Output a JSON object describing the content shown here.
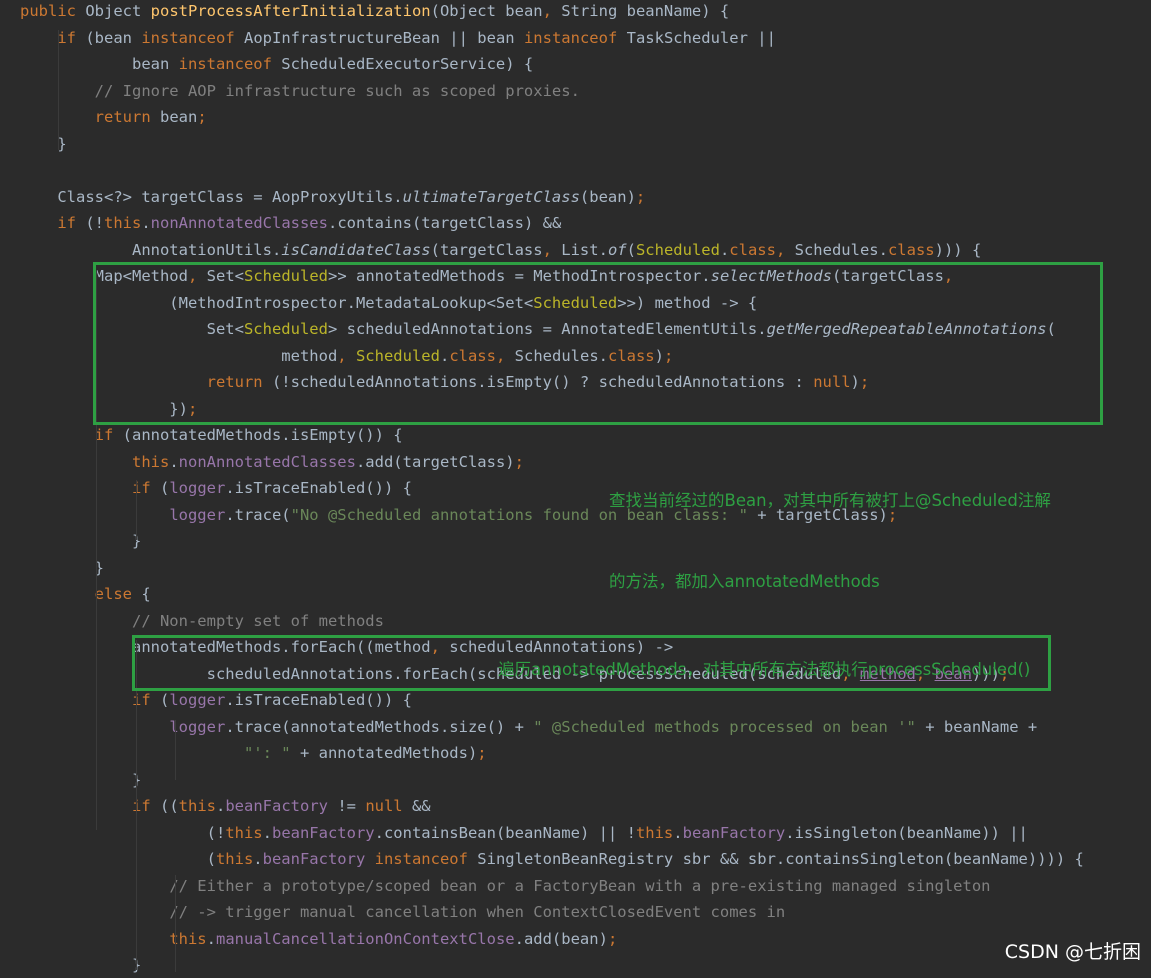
{
  "code": {
    "lines": [
      [
        "public Object postProcessAfterInitialization(Object bean, String beanName) {"
      ],
      [
        "    if (bean instanceof AopInfrastructureBean || bean instanceof TaskScheduler ||"
      ],
      [
        "            bean instanceof ScheduledExecutorService) {"
      ],
      [
        "        // Ignore AOP infrastructure such as scoped proxies."
      ],
      [
        "        return bean;"
      ],
      [
        "    }"
      ],
      [
        ""
      ],
      [
        "    Class<?> targetClass = AopProxyUtils.ultimateTargetClass(bean);"
      ],
      [
        "    if (!this.nonAnnotatedClasses.contains(targetClass) &&"
      ],
      [
        "            AnnotationUtils.isCandidateClass(targetClass, List.of(Scheduled.class, Schedules.class))) {"
      ],
      [
        "        Map<Method, Set<Scheduled>> annotatedMethods = MethodIntrospector.selectMethods(targetClass,"
      ],
      [
        "                (MethodIntrospector.MetadataLookup<Set<Scheduled>>) method -> {"
      ],
      [
        "                    Set<Scheduled> scheduledAnnotations = AnnotatedElementUtils.getMergedRepeatableAnnotations("
      ],
      [
        "                            method, Scheduled.class, Schedules.class);"
      ],
      [
        "                    return (!scheduledAnnotations.isEmpty() ? scheduledAnnotations : null);"
      ],
      [
        "                });"
      ],
      [
        "        if (annotatedMethods.isEmpty()) {"
      ],
      [
        "            this.nonAnnotatedClasses.add(targetClass);"
      ],
      [
        "            if (logger.isTraceEnabled()) {"
      ],
      [
        "                logger.trace(\"No @Scheduled annotations found on bean class: \" + targetClass);"
      ],
      [
        "            }"
      ],
      [
        "        }"
      ],
      [
        "        else {"
      ],
      [
        "            // Non-empty set of methods"
      ],
      [
        "            annotatedMethods.forEach((method, scheduledAnnotations) ->"
      ],
      [
        "                    scheduledAnnotations.forEach(scheduled -> processScheduled(scheduled, method, bean)));"
      ],
      [
        "            if (logger.isTraceEnabled()) {"
      ],
      [
        "                logger.trace(annotatedMethods.size() + \" @Scheduled methods processed on bean '\" + beanName +"
      ],
      [
        "                        \"': \" + annotatedMethods);"
      ],
      [
        "            }"
      ],
      [
        "            if ((this.beanFactory != null &&"
      ],
      [
        "                    (!this.beanFactory.containsBean(beanName) || !this.beanFactory.isSingleton(beanName)) ||"
      ],
      [
        "                    (this.beanFactory instanceof SingletonBeanRegistry sbr && sbr.containsSingleton(beanName)))) {"
      ],
      [
        "                // Either a prototype/scoped bean or a FactoryBean with a pre-existing managed singleton"
      ],
      [
        "                // -> trigger manual cancellation when ContextClosedEvent comes in"
      ],
      [
        "                this.manualCancellationOnContextClose.add(bean);"
      ],
      [
        "            }"
      ]
    ]
  },
  "annotations": {
    "note1_line1": "查找当前经过的Bean，对其中所有被打上@Scheduled注解",
    "note1_line2": "的方法，都加入annotatedMethods",
    "note2": "遍历annotatedMethods，对其中所有方法都执行processScheduled()"
  },
  "colors": {
    "background": "#2b2b2b",
    "keyword": "#cc7832",
    "field": "#9876aa",
    "annotation": "#bbb529",
    "string": "#6a8759",
    "comment": "#808080",
    "text": "#a9b7c6",
    "highlight": "#2ea043"
  },
  "watermark": "CSDN @七折困"
}
